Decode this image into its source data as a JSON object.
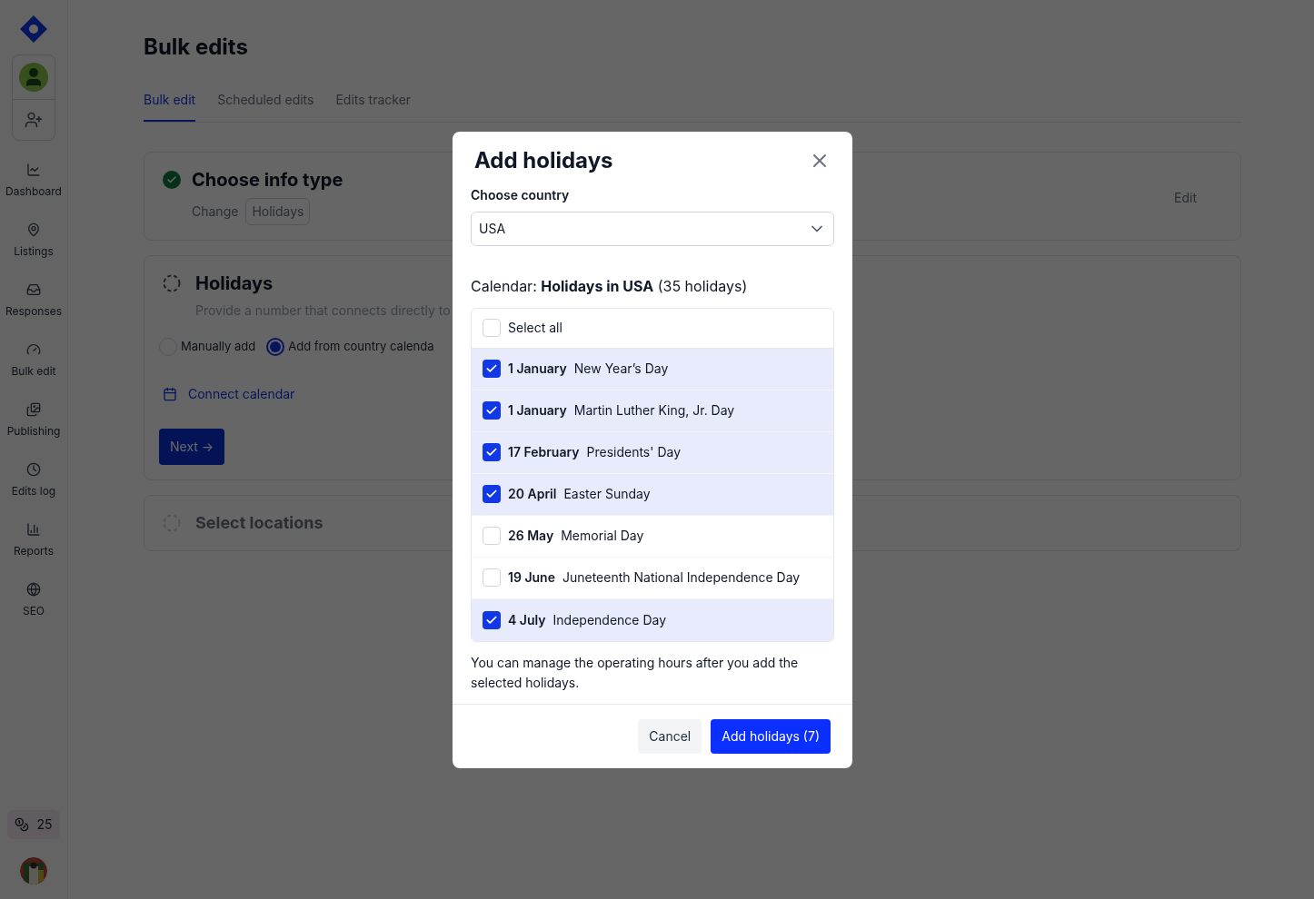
{
  "sidebar": {
    "nav_items": [
      {
        "label": "Dashboard"
      },
      {
        "label": "Listings"
      },
      {
        "label": "Responses"
      },
      {
        "label": "Bulk edit"
      },
      {
        "label": "Publishing"
      },
      {
        "label": "Edits log"
      },
      {
        "label": "Reports"
      },
      {
        "label": "SEO"
      }
    ],
    "credits": "25"
  },
  "page": {
    "title": "Bulk edits",
    "tabs": [
      {
        "label": "Bulk edit",
        "selected": true
      },
      {
        "label": "Scheduled edits",
        "selected": false
      },
      {
        "label": "Edits tracker",
        "selected": false
      }
    ],
    "steps": [
      {
        "kind": "summary",
        "title": "Choose info type",
        "change_label": "Change",
        "value": "Holidays",
        "action": "Edit"
      },
      {
        "kind": "form",
        "title": "Holidays",
        "description": "Provide a number that connects directly to",
        "options": [
          {
            "label": "Manually add",
            "selected": false
          },
          {
            "label": "Add from country calenda",
            "selected": true
          }
        ],
        "link": "Connect calendar",
        "button": "Next →"
      },
      {
        "kind": "collapsed",
        "title": "Select locations"
      }
    ]
  },
  "dialog": {
    "title": "Add holidays",
    "country_label": "Choose country",
    "country": "USA",
    "calendar_heading": "Calendar: **Holidays in USA** (35 holidays)",
    "select_all": {
      "label": "Select all",
      "checked": false
    },
    "holidays": [
      {
        "date": "1 January",
        "name": "New Year’s Day",
        "checked": true
      },
      {
        "date": "1 January",
        "name": "Martin Luther King, Jr. Day",
        "checked": true
      },
      {
        "date": "17 February",
        "name": "Presidents' Day",
        "checked": true
      },
      {
        "date": "20 April",
        "name": "Easter Sunday",
        "checked": true
      },
      {
        "date": "26 May",
        "name": "Memorial Day",
        "checked": false
      },
      {
        "date": "19 June",
        "name": "Juneteenth National Independence Day",
        "checked": false
      },
      {
        "date": "4 July",
        "name": "Independence Day",
        "checked": true
      }
    ],
    "note": "You can manage the operating hours after you add the selected holidays.",
    "buttons": [
      {
        "kind": "secondary",
        "label": "Cancel"
      },
      {
        "kind": "primary",
        "label": "Add holidays (7)"
      }
    ]
  }
}
